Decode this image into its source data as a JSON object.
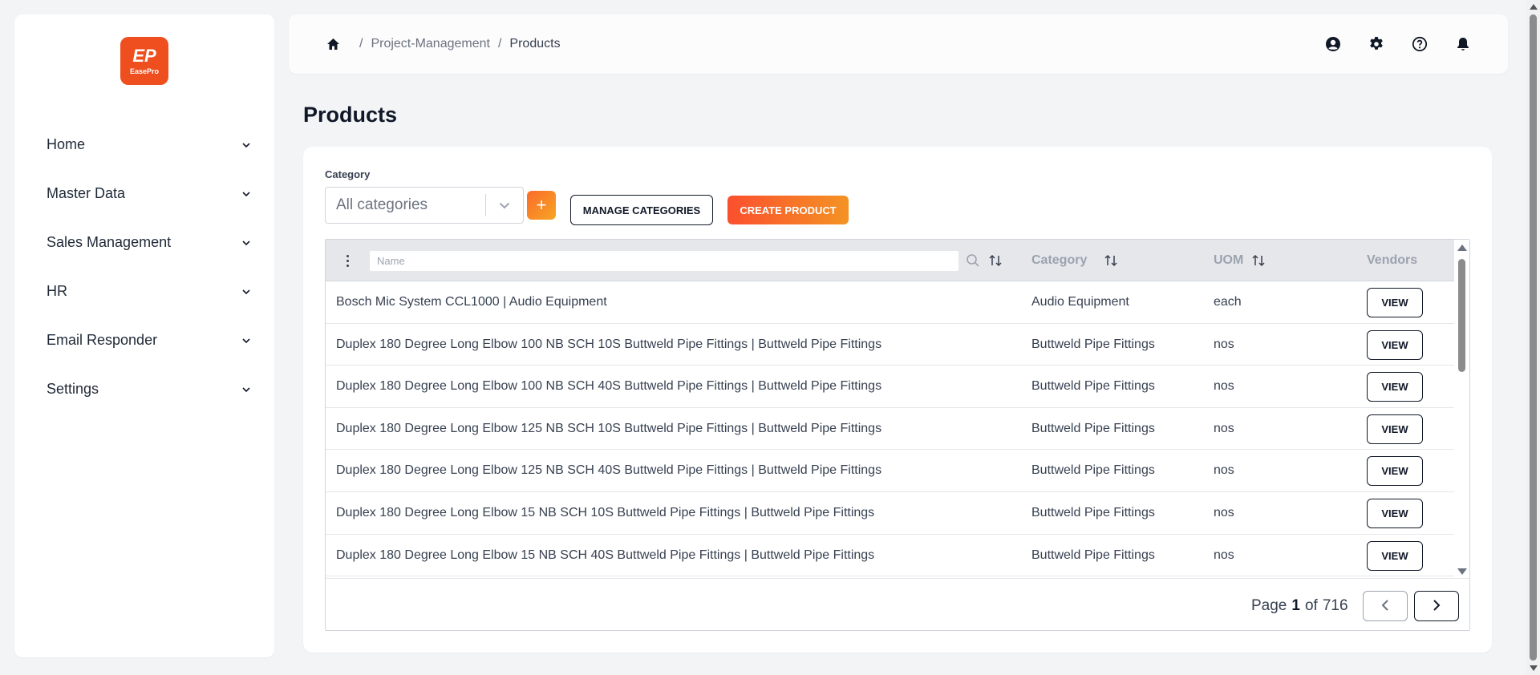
{
  "brand": {
    "logo_mark": "EP",
    "logo_text": "EasePro",
    "accent_color": "#ef4f1f"
  },
  "sidebar": {
    "items": [
      {
        "label": "Home",
        "icon": "chevron-down-icon"
      },
      {
        "label": "Master Data",
        "icon": "chevron-down-icon"
      },
      {
        "label": "Sales Management",
        "icon": "chevron-down-icon"
      },
      {
        "label": "HR",
        "icon": "chevron-down-icon"
      },
      {
        "label": "Email Responder",
        "icon": "chevron-down-icon"
      },
      {
        "label": "Settings",
        "icon": "chevron-down-icon"
      }
    ]
  },
  "header": {
    "breadcrumb": {
      "home_icon": "home-icon",
      "separator": "/",
      "parent": "Project-Management",
      "current": "Products"
    },
    "icons": [
      "user-icon",
      "gear-icon",
      "help-icon",
      "bell-icon"
    ]
  },
  "page": {
    "title": "Products"
  },
  "filters": {
    "category_label": "Category",
    "category_value": "All categories",
    "add_label": "+",
    "manage_categories_label": "MANAGE CATEGORIES",
    "create_product_label": "CREATE PRODUCT"
  },
  "table": {
    "name_filter_placeholder": "Name",
    "columns": {
      "category": "Category",
      "uom": "UOM",
      "vendors": "Vendors"
    },
    "view_label": "VIEW",
    "rows": [
      {
        "name": "Bosch Mic System CCL1000 | Audio Equipment",
        "category": "Audio Equipment",
        "uom": "each"
      },
      {
        "name": "Duplex 180 Degree Long Elbow 100 NB SCH 10S Buttweld Pipe Fittings | Buttweld Pipe Fittings",
        "category": "Buttweld Pipe Fittings",
        "uom": "nos"
      },
      {
        "name": "Duplex 180 Degree Long Elbow 100 NB SCH 40S Buttweld Pipe Fittings | Buttweld Pipe Fittings",
        "category": "Buttweld Pipe Fittings",
        "uom": "nos"
      },
      {
        "name": "Duplex 180 Degree Long Elbow 125 NB SCH 10S Buttweld Pipe Fittings | Buttweld Pipe Fittings",
        "category": "Buttweld Pipe Fittings",
        "uom": "nos"
      },
      {
        "name": "Duplex 180 Degree Long Elbow 125 NB SCH 40S Buttweld Pipe Fittings | Buttweld Pipe Fittings",
        "category": "Buttweld Pipe Fittings",
        "uom": "nos"
      },
      {
        "name": "Duplex 180 Degree Long Elbow 15 NB SCH 10S Buttweld Pipe Fittings | Buttweld Pipe Fittings",
        "category": "Buttweld Pipe Fittings",
        "uom": "nos"
      },
      {
        "name": "Duplex 180 Degree Long Elbow 15 NB SCH 40S Buttweld Pipe Fittings | Buttweld Pipe Fittings",
        "category": "Buttweld Pipe Fittings",
        "uom": "nos"
      }
    ]
  },
  "pagination": {
    "page_word": "Page",
    "current": "1",
    "of_word": "of",
    "total": "716"
  }
}
